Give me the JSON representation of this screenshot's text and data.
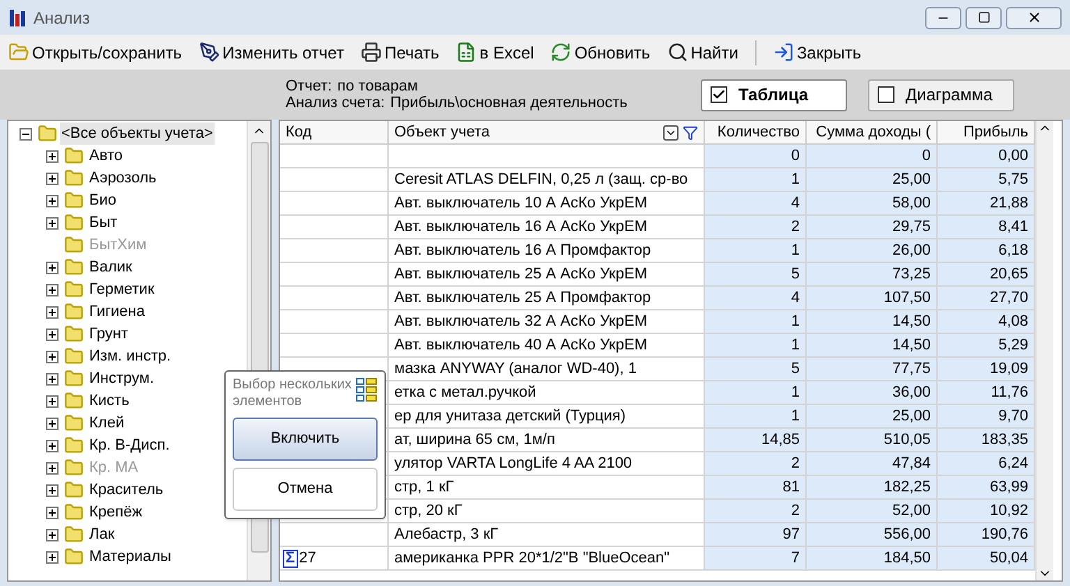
{
  "window": {
    "title": "Анализ"
  },
  "toolbar": [
    {
      "label": "Открыть/сохранить",
      "kind": "open"
    },
    {
      "label": "Изменить отчет",
      "kind": "edit"
    },
    {
      "label": "Печать",
      "kind": "print"
    },
    {
      "label": "в Excel",
      "kind": "excel"
    },
    {
      "label": "Обновить",
      "kind": "refresh"
    },
    {
      "label": "Найти",
      "kind": "find"
    },
    {
      "label": "Закрыть",
      "kind": "close"
    }
  ],
  "report": {
    "report_label": "Отчет:",
    "report_value": "по товарам",
    "account_label": "Анализ счета:",
    "account_value": "Прибыль\\основная деятельность"
  },
  "view_toggles": [
    {
      "label": "Таблица",
      "checked": true
    },
    {
      "label": "Диаграмма",
      "checked": false
    }
  ],
  "tree": {
    "label": "<Все объекты учета>",
    "selected": true,
    "expanded": true,
    "children": [
      {
        "label": "Авто",
        "expandable": true,
        "disabled": false
      },
      {
        "label": "Аэрозоль",
        "expandable": true,
        "disabled": false
      },
      {
        "label": "Био",
        "expandable": true,
        "disabled": false
      },
      {
        "label": "Быт",
        "expandable": true,
        "disabled": false
      },
      {
        "label": "БытХим",
        "expandable": false,
        "disabled": true
      },
      {
        "label": "Валик",
        "expandable": true,
        "disabled": false
      },
      {
        "label": "Герметик",
        "expandable": true,
        "disabled": false
      },
      {
        "label": "Гигиена",
        "expandable": true,
        "disabled": false
      },
      {
        "label": "Грунт",
        "expandable": true,
        "disabled": false
      },
      {
        "label": "Изм. инстр.",
        "expandable": true,
        "disabled": false
      },
      {
        "label": "Инструм.",
        "expandable": true,
        "disabled": false
      },
      {
        "label": "Кисть",
        "expandable": true,
        "disabled": false
      },
      {
        "label": "Клей",
        "expandable": true,
        "disabled": false
      },
      {
        "label": "Кр. В-Дисп.",
        "expandable": true,
        "disabled": false
      },
      {
        "label": "Кр. МА",
        "expandable": true,
        "disabled": true
      },
      {
        "label": "Краситель",
        "expandable": true,
        "disabled": false
      },
      {
        "label": "Крепёж",
        "expandable": true,
        "disabled": false
      },
      {
        "label": "Лак",
        "expandable": true,
        "disabled": false
      },
      {
        "label": "Материалы",
        "expandable": true,
        "disabled": false
      }
    ]
  },
  "table": {
    "columns": [
      "Код",
      "Объект учета",
      "Количество",
      "Сумма доходы (",
      "Прибыль"
    ],
    "rows": [
      [
        "",
        "",
        "0",
        "0",
        "0,00"
      ],
      [
        "",
        "Ceresit ATLAS DELFIN, 0,25 л (защ. ср-во",
        "1",
        "25,00",
        "5,75"
      ],
      [
        "",
        "Авт. выключатель 10 А АсКо УкрЕМ",
        "4",
        "58,00",
        "21,88"
      ],
      [
        "",
        "Авт. выключатель 16 А АсКо УкрЕМ",
        "2",
        "29,75",
        "8,41"
      ],
      [
        "",
        "Авт. выключатель 16 А Промфактор",
        "1",
        "26,00",
        "6,18"
      ],
      [
        "",
        "Авт. выключатель 25 А АсКо УкрЕМ",
        "5",
        "73,25",
        "20,65"
      ],
      [
        "",
        "Авт. выключатель 25 А Промфактор",
        "4",
        "107,50",
        "27,70"
      ],
      [
        "",
        "Авт. выключатель 32 А АсКо УкрЕМ",
        "1",
        "14,50",
        "4,08"
      ],
      [
        "",
        "Авт. выключатель 40 А АсКо УкрЕМ",
        "1",
        "14,50",
        "5,29"
      ],
      [
        "",
        "мазка ANYWAY (аналог WD-40), 1",
        "5",
        "77,75",
        "19,09"
      ],
      [
        "",
        "етка с метал.ручкой",
        "1",
        "36,00",
        "11,76"
      ],
      [
        "",
        "ер для унитаза детский (Турция)",
        "1",
        "25,00",
        "9,70"
      ],
      [
        "",
        "ат, ширина 65 см, 1м/п",
        "14,85",
        "510,05",
        "183,35"
      ],
      [
        "",
        "улятор VARTA LongLife 4 AA 2100",
        "2",
        "47,84",
        "6,24"
      ],
      [
        "",
        "стр, 1 кГ",
        "81",
        "182,25",
        "63,99"
      ],
      [
        "",
        "стр, 20 кГ",
        "2",
        "52,00",
        "10,92"
      ],
      [
        "",
        "Алебастр, 3 кГ",
        "97",
        "556,00",
        "190,76"
      ]
    ],
    "footer": {
      "sigma": "Σ",
      "count": "27",
      "cells": [
        "американка PPR 20*1/2\"В \"BlueOcean\"",
        "7",
        "184,50",
        "50,04"
      ]
    }
  },
  "popup": {
    "title": "Выбор нескольких элементов",
    "buttons": [
      "Включить",
      "Отмена"
    ]
  }
}
